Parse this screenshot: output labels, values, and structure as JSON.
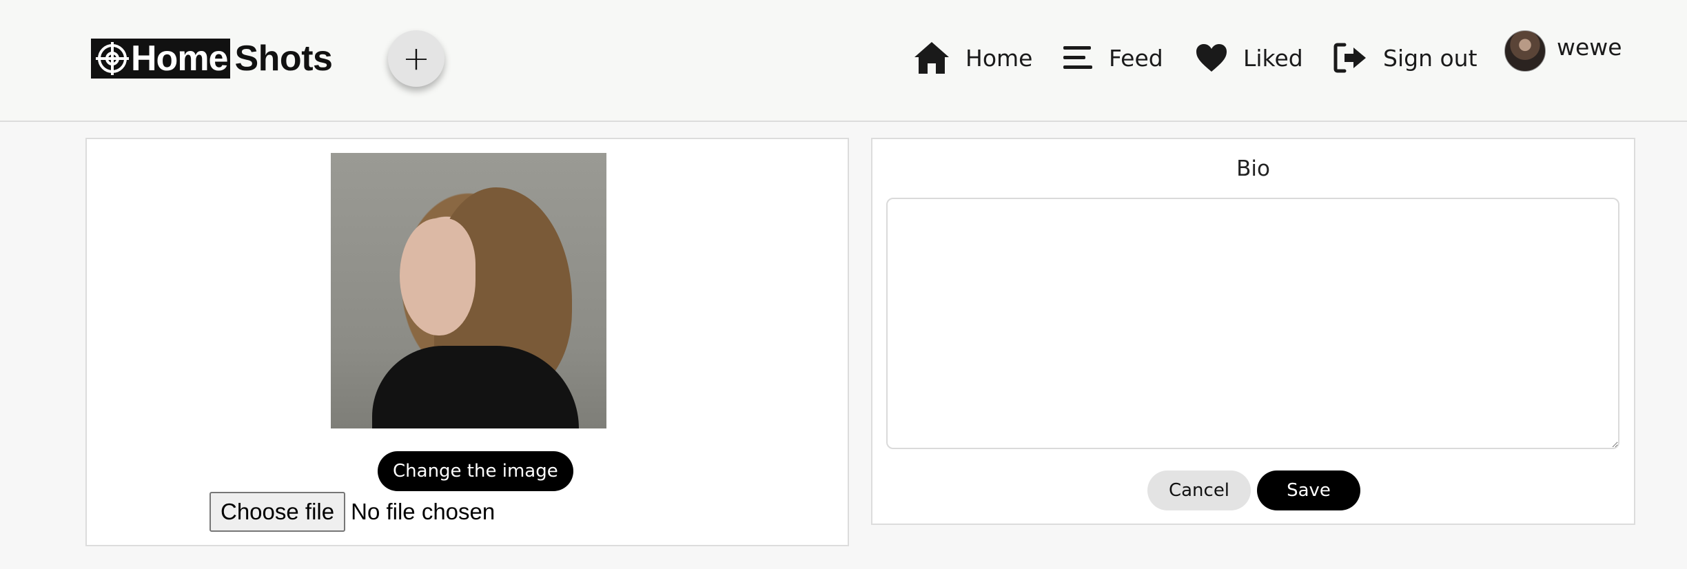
{
  "header": {
    "logo_part1": "Home",
    "logo_part2": "Shots",
    "add_label": "+",
    "nav": {
      "home": "Home",
      "feed": "Feed",
      "liked": "Liked",
      "signout": "Sign out",
      "username": "wewe"
    }
  },
  "profile": {
    "change_image_label": "Change the image",
    "choose_file_label": "Choose file",
    "file_status": "No file chosen"
  },
  "bio": {
    "label": "Bio",
    "value": "",
    "cancel_label": "Cancel",
    "save_label": "Save"
  },
  "icons": {
    "logo": "crosshair-icon",
    "home": "home-icon",
    "feed": "menu-icon",
    "liked": "heart-icon",
    "signout": "sign-out-icon"
  },
  "colors": {
    "primary_button": "#000000",
    "secondary_button": "#e3e3e3",
    "header_bg": "#f7f8f6",
    "page_bg": "#f7f7f7"
  }
}
